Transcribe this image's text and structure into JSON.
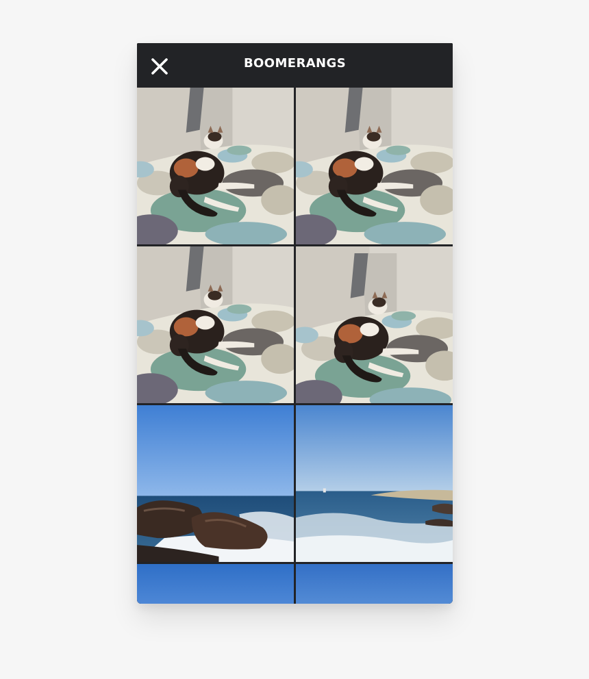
{
  "header": {
    "title": "BOOMERANGS",
    "close_icon": "close-icon"
  },
  "grid": {
    "items": [
      {
        "kind": "cat-on-bed"
      },
      {
        "kind": "cat-on-bed"
      },
      {
        "kind": "cat-on-bed"
      },
      {
        "kind": "cat-on-bed"
      },
      {
        "kind": "sea-rocks"
      },
      {
        "kind": "sea-coast"
      },
      {
        "kind": "sky"
      },
      {
        "kind": "sky"
      }
    ]
  },
  "colors": {
    "header_bg": "#222326",
    "title_text": "#ffffff",
    "page_bg": "#f6f6f6"
  }
}
